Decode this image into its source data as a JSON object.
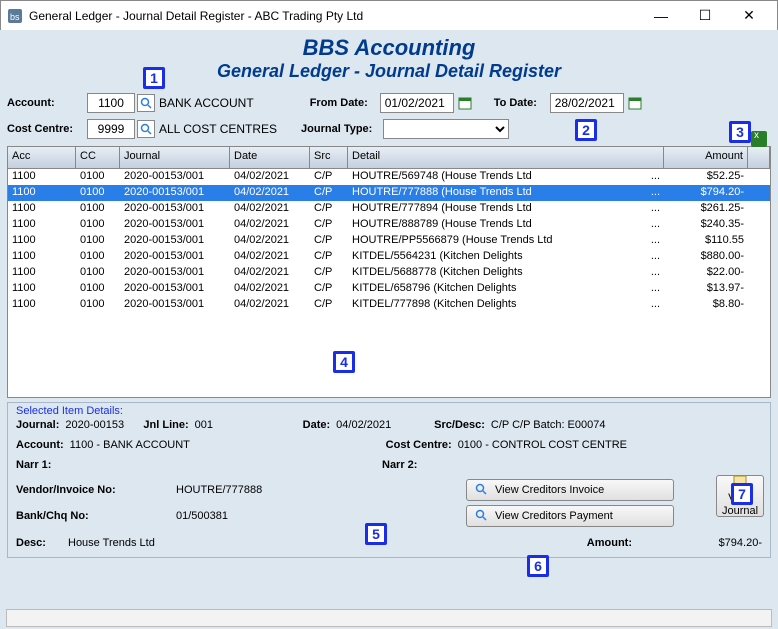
{
  "window": {
    "title": "General Ledger - Journal Detail Register - ABC Trading Pty Ltd"
  },
  "header": {
    "app": "BBS Accounting",
    "page": "General Ledger - Journal Detail Register"
  },
  "filters": {
    "account_label": "Account:",
    "account_value": "1100",
    "account_name": "BANK ACCOUNT",
    "from_label": "From Date:",
    "from_value": "01/02/2021",
    "to_label": "To Date:",
    "to_value": "28/02/2021",
    "cc_label": "Cost Centre:",
    "cc_value": "9999",
    "cc_name": "ALL COST CENTRES",
    "jtype_label": "Journal Type:",
    "jtype_value": ""
  },
  "columns": {
    "acc": "Acc",
    "cc": "CC",
    "jnl": "Journal",
    "date": "Date",
    "src": "Src",
    "det": "Detail",
    "amt": "Amount"
  },
  "rows": [
    {
      "acc": "1100",
      "cc": "0100",
      "jnl": "2020-00153/001",
      "date": "04/02/2021",
      "src": "C/P",
      "det": "HOUTRE/569748      (House Trends Ltd",
      "ell": "...",
      "amt": "$52.25-"
    },
    {
      "acc": "1100",
      "cc": "0100",
      "jnl": "2020-00153/001",
      "date": "04/02/2021",
      "src": "C/P",
      "det": "HOUTRE/777888      (House Trends Ltd",
      "ell": "...",
      "amt": "$794.20-",
      "sel": true
    },
    {
      "acc": "1100",
      "cc": "0100",
      "jnl": "2020-00153/001",
      "date": "04/02/2021",
      "src": "C/P",
      "det": "HOUTRE/777894      (House Trends Ltd",
      "ell": "...",
      "amt": "$261.25-"
    },
    {
      "acc": "1100",
      "cc": "0100",
      "jnl": "2020-00153/001",
      "date": "04/02/2021",
      "src": "C/P",
      "det": "HOUTRE/888789      (House Trends Ltd",
      "ell": "...",
      "amt": "$240.35-"
    },
    {
      "acc": "1100",
      "cc": "0100",
      "jnl": "2020-00153/001",
      "date": "04/02/2021",
      "src": "C/P",
      "det": "HOUTRE/PP5566879   (House Trends Ltd",
      "ell": "...",
      "amt": "$110.55"
    },
    {
      "acc": "1100",
      "cc": "0100",
      "jnl": "2020-00153/001",
      "date": "04/02/2021",
      "src": "C/P",
      "det": "KITDEL/5564231    (Kitchen Delights",
      "ell": "...",
      "amt": "$880.00-"
    },
    {
      "acc": "1100",
      "cc": "0100",
      "jnl": "2020-00153/001",
      "date": "04/02/2021",
      "src": "C/P",
      "det": "KITDEL/5688778    (Kitchen Delights",
      "ell": "...",
      "amt": "$22.00-"
    },
    {
      "acc": "1100",
      "cc": "0100",
      "jnl": "2020-00153/001",
      "date": "04/02/2021",
      "src": "C/P",
      "det": "KITDEL/658796     (Kitchen Delights",
      "ell": "...",
      "amt": "$13.97-"
    },
    {
      "acc": "1100",
      "cc": "0100",
      "jnl": "2020-00153/001",
      "date": "04/02/2021",
      "src": "C/P",
      "det": "KITDEL/777898     (Kitchen Delights",
      "ell": "...",
      "amt": "$8.80-"
    }
  ],
  "detail": {
    "legend": "Selected Item Details:",
    "journal_l": "Journal:",
    "journal_v": "2020-00153",
    "jnlline_l": "Jnl Line:",
    "jnlline_v": "001",
    "date_l": "Date:",
    "date_v": "04/02/2021",
    "srcdesc_l": "Src/Desc:",
    "srcdesc_v": "C/P C/P Batch: E00074",
    "account_l": "Account:",
    "account_v": "1100  - BANK ACCOUNT",
    "cc_l": "Cost Centre:",
    "cc_v": "0100 - CONTROL COST CENTRE",
    "narr1_l": "Narr 1:",
    "narr2_l": "Narr 2:",
    "vend_l": "Vendor/Invoice No:",
    "vend_v": "HOUTRE/777888",
    "bank_l": "Bank/Chq No:",
    "bank_v": "01/500381",
    "desc_l": "Desc:",
    "desc_v": "House Trends Ltd",
    "view_inv": "View Creditors Invoice",
    "view_pay": "View Creditors Payment",
    "view_jnl1": "View",
    "view_jnl2": "Journal",
    "amount_l": "Amount:",
    "amount_v": "$794.20-"
  },
  "callouts": {
    "c1": "1",
    "c2": "2",
    "c3": "3",
    "c4": "4",
    "c5": "5",
    "c6": "6",
    "c7": "7"
  }
}
